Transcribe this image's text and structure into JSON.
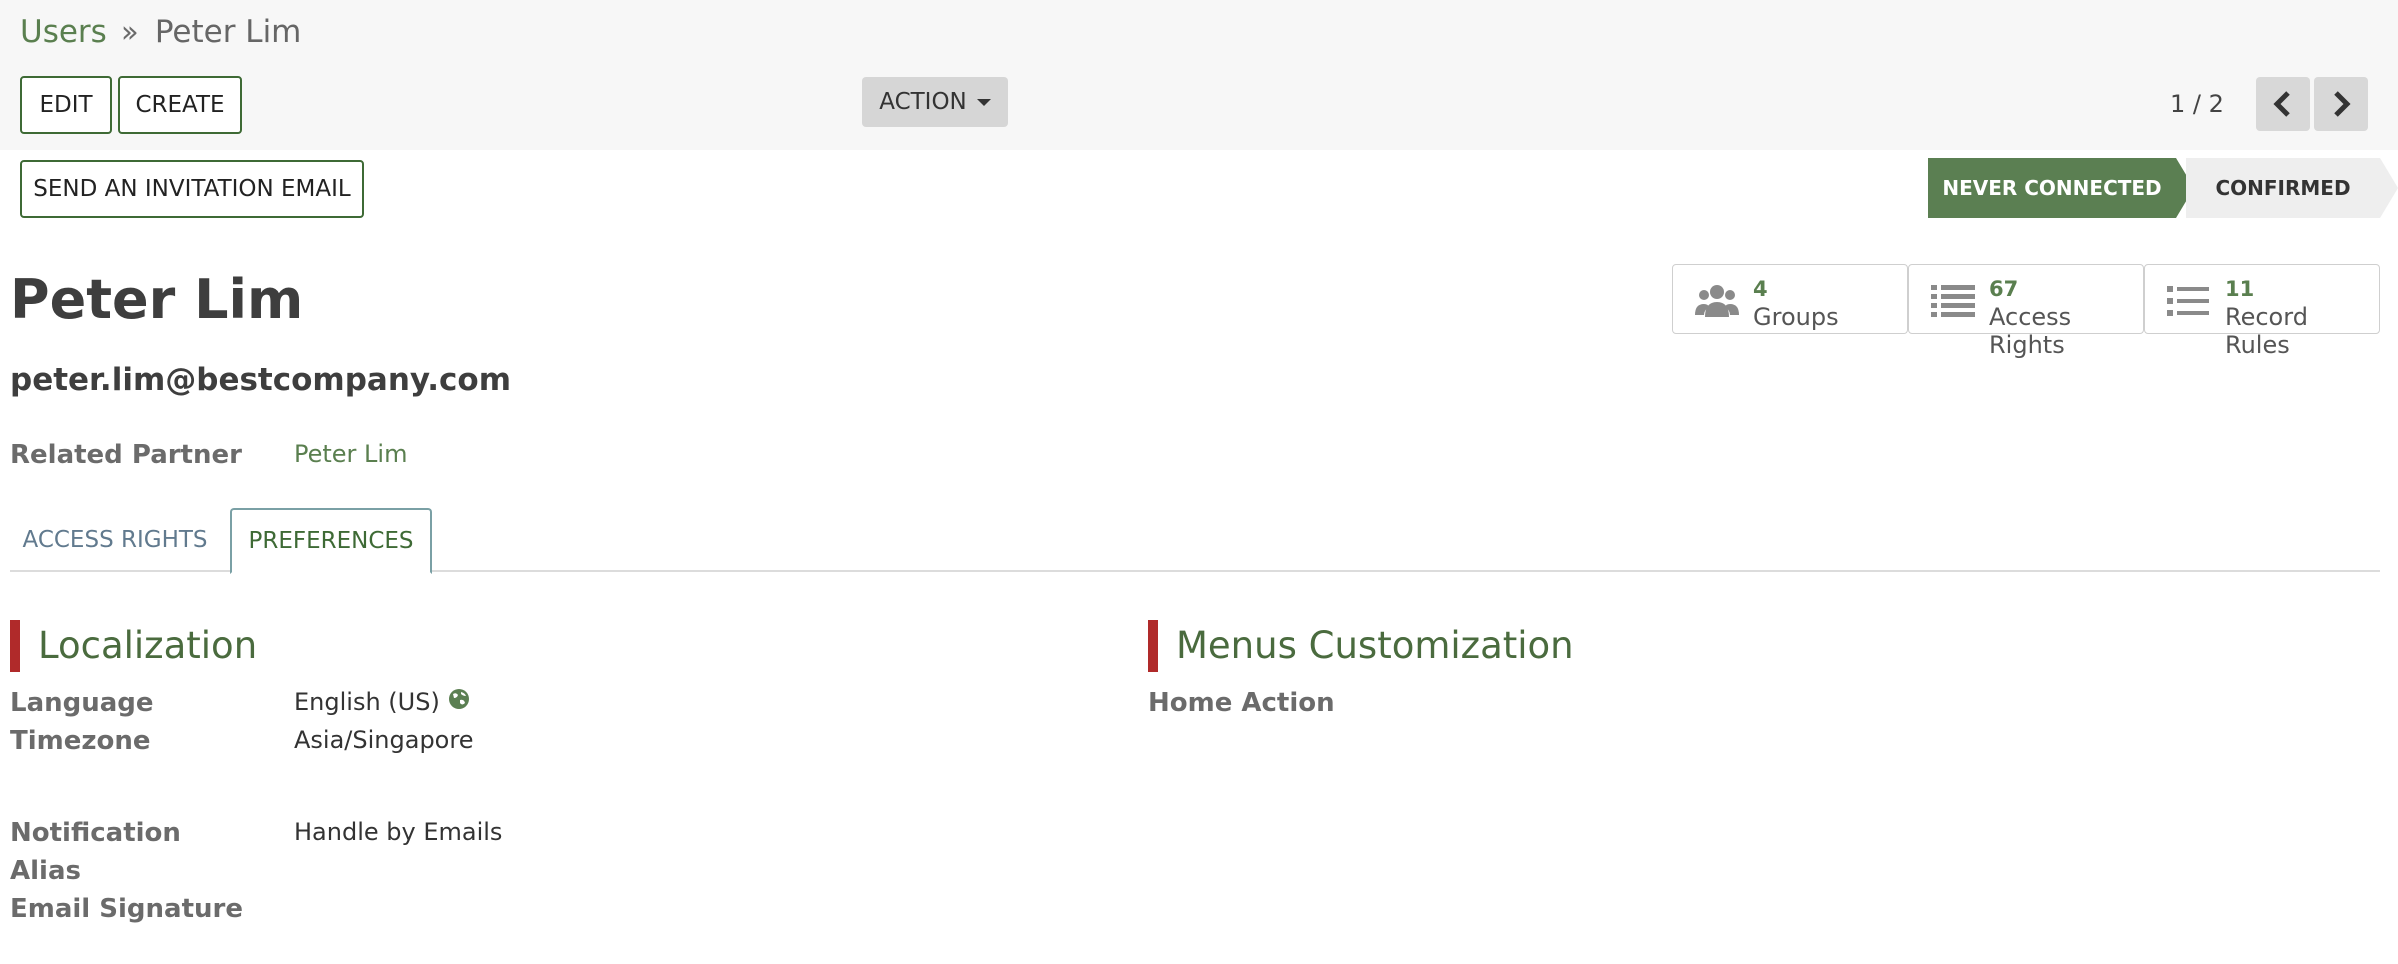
{
  "breadcrumb": {
    "parent": "Users",
    "current": "Peter Lim"
  },
  "toolbar": {
    "edit_label": "EDIT",
    "create_label": "CREATE",
    "action_label": "ACTION"
  },
  "pager": {
    "value": "1 / 2"
  },
  "header": {
    "invite_label": "SEND AN INVITATION EMAIL"
  },
  "status": {
    "stages": [
      "NEVER CONNECTED",
      "CONFIRMED"
    ],
    "active": "NEVER CONNECTED"
  },
  "record": {
    "name": "Peter Lim",
    "email": "peter.lim@bestcompany.com"
  },
  "stats": [
    {
      "count": "4",
      "label": "Groups",
      "icon": "users-icon"
    },
    {
      "count": "67",
      "label": "Access Rights",
      "icon": "list-icon"
    },
    {
      "count": "11",
      "label": "Record Rules",
      "icon": "list-icon"
    }
  ],
  "fields": {
    "related_partner_label": "Related Partner",
    "related_partner_value": "Peter Lim"
  },
  "tabs": [
    {
      "label": "ACCESS RIGHTS"
    },
    {
      "label": "PREFERENCES"
    }
  ],
  "localization": {
    "title": "Localization",
    "language_label": "Language",
    "language_value": "English (US)",
    "timezone_label": "Timezone",
    "timezone_value": "Asia/Singapore",
    "notification_label": "Notification",
    "notification_value": "Handle by Emails",
    "alias_label": "Alias",
    "signature_label": "Email Signature"
  },
  "menus": {
    "title": "Menus Customization",
    "home_action_label": "Home Action"
  },
  "colors": {
    "accent": "#5b7f52",
    "link": "#5a7f4f",
    "section_bar": "#b02a2a"
  }
}
